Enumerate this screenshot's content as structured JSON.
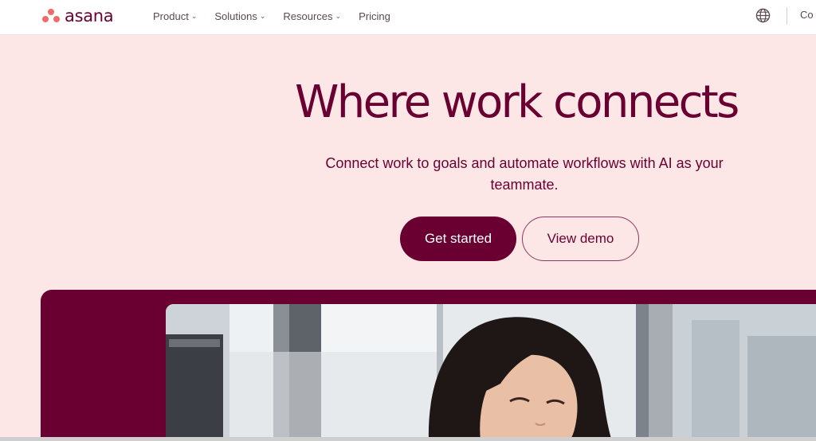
{
  "brand": {
    "name": "asana",
    "dot_color": "#f06a6a",
    "text_color": "#690031"
  },
  "nav": {
    "items": [
      {
        "label": "Product",
        "has_dropdown": true
      },
      {
        "label": "Solutions",
        "has_dropdown": true
      },
      {
        "label": "Resources",
        "has_dropdown": true
      },
      {
        "label": "Pricing",
        "has_dropdown": false
      }
    ],
    "globe_icon": "globe-icon",
    "cut_off_label": "Co"
  },
  "hero": {
    "title": "Where work connects",
    "subtitle": "Connect work to goals and automate workflows with AI as your teammate.",
    "primary_cta": "Get started",
    "secondary_cta": "View demo"
  },
  "colors": {
    "background": "#fde6e6",
    "accent": "#690031",
    "header_bg": "#ffffff"
  },
  "media": {
    "description_icon": "hero-photo"
  }
}
